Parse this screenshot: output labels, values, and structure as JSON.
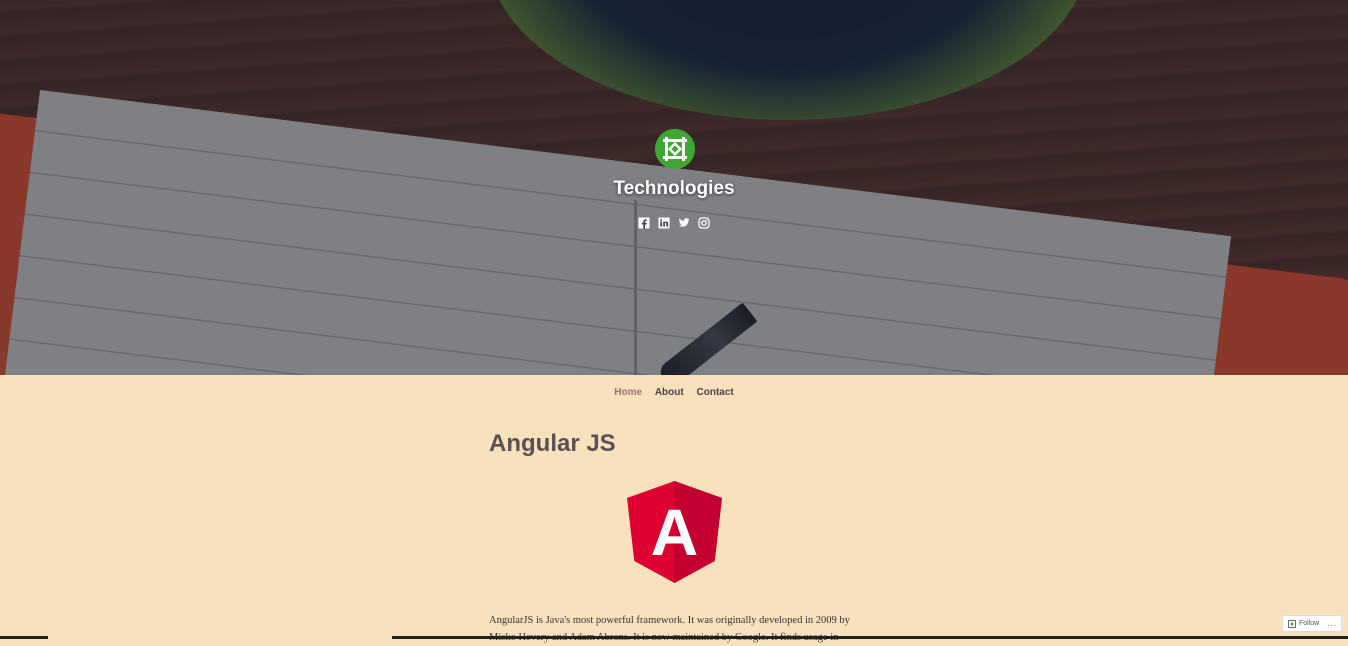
{
  "site": {
    "title": "Technologies",
    "social": [
      {
        "icon": "facebook-icon"
      },
      {
        "icon": "linkedin-icon"
      },
      {
        "icon": "twitter-icon"
      },
      {
        "icon": "instagram-icon"
      }
    ]
  },
  "nav": {
    "items": [
      {
        "label": "Home",
        "current": true
      },
      {
        "label": "About",
        "current": false
      },
      {
        "label": "Contact",
        "current": false
      }
    ]
  },
  "post": {
    "title": "Angular JS",
    "logo_letter": "A",
    "body": "AngularJS is Java's most powerful framework. It was originally developed in 2009 by Misko Hevery and Adam Abrons. It is now maintained by Google. It finds usage in"
  },
  "follow": {
    "label": "Follow",
    "more": "..."
  },
  "colors": {
    "background": "#f7e2bd",
    "angular_red": "#dd0031",
    "angular_dark_red": "#c3002f",
    "logo_green": "#3fa535",
    "nav_current": "#9a6f70"
  }
}
